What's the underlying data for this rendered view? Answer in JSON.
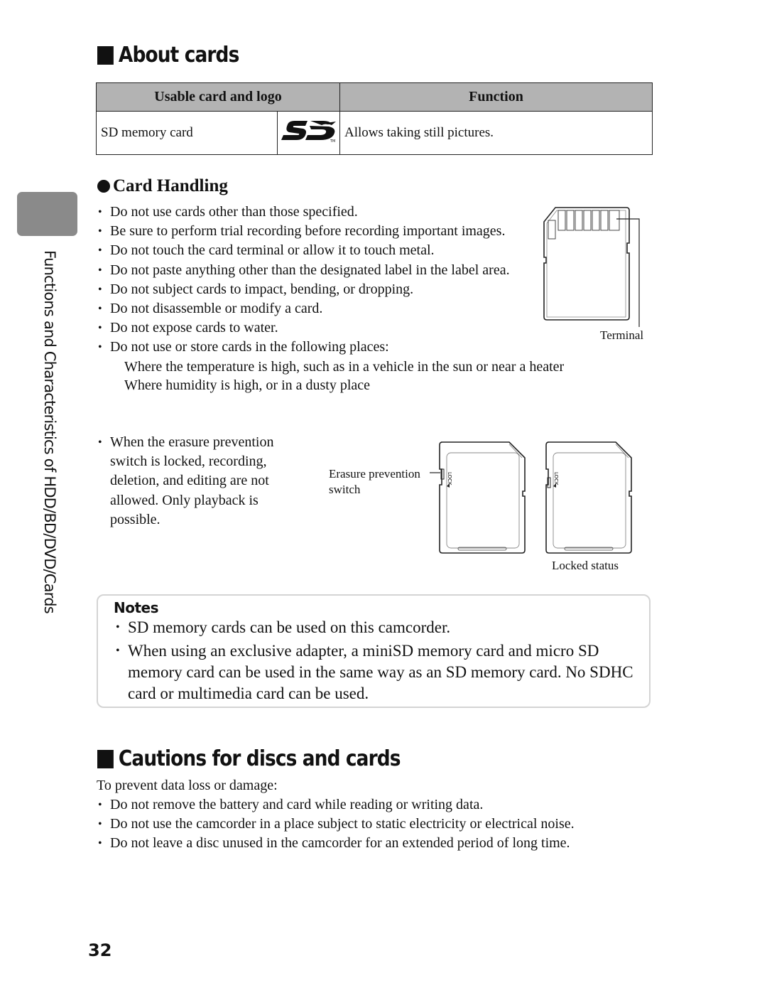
{
  "side_tab": {
    "label": "Functions and Characteristics of HDD/BD/DVD/Cards"
  },
  "about_cards": {
    "title": "About cards",
    "table": {
      "headers": [
        "Usable card and logo",
        "Function"
      ],
      "rows": [
        {
          "card": "SD memory card",
          "logo": "sd-logo-icon",
          "function": "Allows taking still pictures."
        }
      ]
    }
  },
  "card_handling": {
    "title": "Card Handling",
    "items": [
      "Do not use cards other than those specified.",
      "Be sure to perform trial recording before recording important images.",
      "Do not touch the card terminal or allow it to touch metal.",
      "Do not paste anything other than the designated label in the label area.",
      "Do not subject cards to impact, bending, or dropping.",
      "Do not disassemble or modify a card.",
      "Do not expose cards to water.",
      "Do not use or store cards in the following places:"
    ],
    "places": [
      "Where the temperature is high, such as in a vehicle in the sun or near a heater",
      "Where humidity is high, or in a dusty place"
    ],
    "erasure_item": "When the erasure prevention switch is locked, recording, deletion, and editing are not allowed. Only playback is possible.",
    "diagram_labels": {
      "terminal": "Terminal",
      "erasure_switch_line1": "Erasure prevention",
      "erasure_switch_line2": "switch",
      "locked_status": "Locked status",
      "lock_text": "LOCK"
    }
  },
  "notes": {
    "title": "Notes",
    "items": [
      "SD memory cards can be used on this camcorder.",
      "When using an exclusive adapter, a miniSD memory card and micro SD memory card can be used in the same way as an SD memory card. No SDHC card or multimedia card can be used."
    ]
  },
  "cautions": {
    "title": "Cautions for discs and cards",
    "intro": "To prevent data loss or damage:",
    "items": [
      "Do not remove the battery and card while reading or writing data.",
      "Do not use the camcorder in a place subject to static electricity or electrical noise.",
      "Do not leave a disc unused in the camcorder for an extended period of long time."
    ]
  },
  "page_number": "32"
}
